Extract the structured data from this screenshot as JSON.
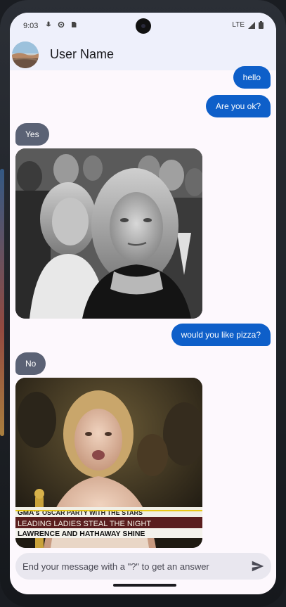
{
  "status_bar": {
    "time": "9:03",
    "network": "LTE",
    "icons_left": [
      "mic-icon",
      "settings-icon",
      "sim-card-icon"
    ],
    "icons_right": [
      "signal-icon",
      "battery-icon"
    ]
  },
  "header": {
    "user_name": "User Name",
    "avatar_icon": "avatar"
  },
  "messages": [
    {
      "from": "me",
      "text": "hello"
    },
    {
      "from": "me",
      "text": "Are you ok?"
    },
    {
      "from": "them",
      "text": "Yes"
    },
    {
      "from": "them",
      "type": "gif",
      "subject": "woman in black dress in audience"
    },
    {
      "from": "me",
      "text": "would you like pizza?"
    },
    {
      "from": "them",
      "text": "No"
    },
    {
      "from": "them",
      "type": "gif",
      "subject": "woman at oscar party"
    }
  ],
  "gif2_ticker": {
    "line1_brand": "GMA's",
    "line1_rest": "OSCAR PARTY WITH THE STARS",
    "line2": "LEADING LADIES STEAL THE NIGHT",
    "line3": "LAWRENCE AND HATHAWAY SHINE"
  },
  "composer": {
    "placeholder": "End your message with a \"?\" to get an answer",
    "send_icon": "send-icon"
  },
  "colors": {
    "sent_bubble": "#0e5fc9",
    "received_bubble": "#5b6275",
    "app_bar": "#eef0fb",
    "background": "#fdf8fd"
  }
}
